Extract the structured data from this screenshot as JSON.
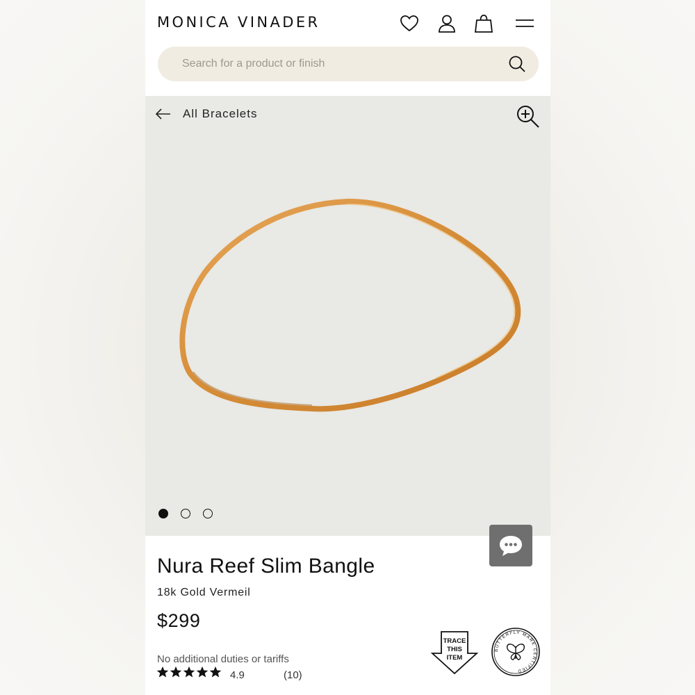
{
  "header": {
    "logo": "MONICA VINADER",
    "icons": [
      "heart-icon",
      "user-icon",
      "bag-icon",
      "menu-icon"
    ]
  },
  "search": {
    "placeholder": "Search for a product or finish"
  },
  "gallery": {
    "back_label": "All Bracelets",
    "slide_count": 3,
    "active_slide": 1
  },
  "product": {
    "title": "Nura Reef Slim Bangle",
    "finish": "18k Gold Vermeil",
    "price": "$299",
    "duties_note": "No additional duties or tariffs",
    "rating_value": "4.9",
    "rating_count": "(10)",
    "stars": 5
  },
  "badges": {
    "trace": [
      "TRACE",
      "THIS",
      "ITEM"
    ],
    "butterfly": "BUTTERFLY MARK CERTIFIED"
  },
  "colors": {
    "search_bg": "#f1ece2",
    "gallery_bg": "#e9e9e5",
    "gold": "#d9963f",
    "chat_bg": "#6f6f6f"
  }
}
